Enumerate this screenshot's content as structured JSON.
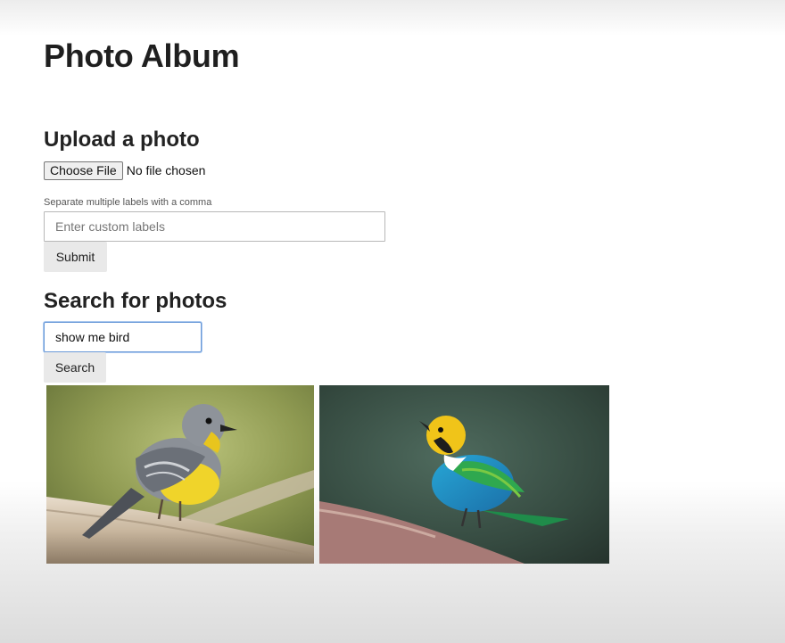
{
  "page": {
    "title": "Photo Album"
  },
  "upload": {
    "heading": "Upload a photo",
    "choose_file_label": "Choose File",
    "file_status": "No file chosen",
    "labels_hint": "Separate multiple labels with a comma",
    "labels_placeholder": "Enter custom labels",
    "submit_label": "Submit"
  },
  "search": {
    "heading": "Search for photos",
    "query_value": "show me bird",
    "search_label": "Search"
  },
  "results": {
    "photos": [
      {
        "subject": "yellow-breasted gray bird on branch"
      },
      {
        "subject": "multicolored green-blue bird on branch"
      }
    ]
  }
}
